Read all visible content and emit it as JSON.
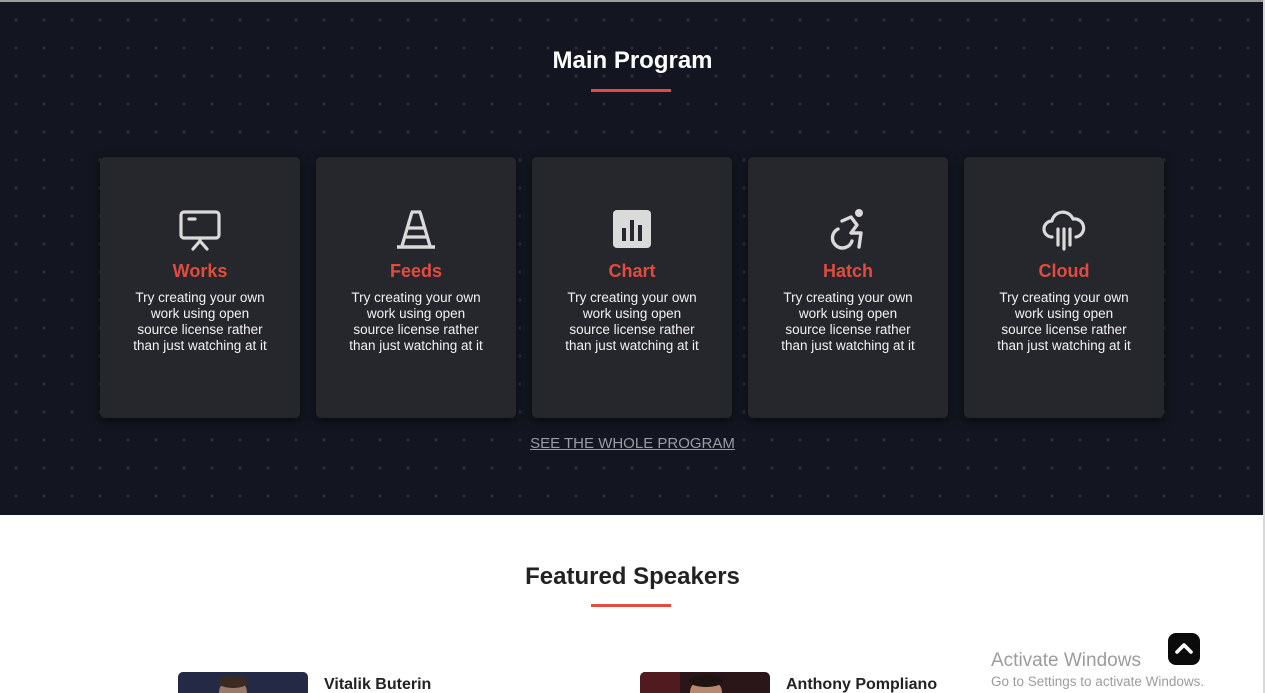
{
  "program": {
    "title": "Main Program",
    "cards": [
      {
        "icon": "presentation-icon",
        "title": "Works",
        "desc": "Try creating your own work using open source license rather than just watching at it"
      },
      {
        "icon": "road-cone-icon",
        "title": "Feeds",
        "desc": "Try creating your own work using open source license rather than just watching at it"
      },
      {
        "icon": "bar-chart-icon",
        "title": "Chart",
        "desc": "Try creating your own work using open source license rather than just watching at it"
      },
      {
        "icon": "accessibility-icon",
        "title": "Hatch",
        "desc": "Try creating your own work using open source license rather than just watching at it"
      },
      {
        "icon": "cloud-download-icon",
        "title": "Cloud",
        "desc": "Try creating your own work using open source license rather than just watching at it"
      }
    ],
    "cta": "SEE THE WHOLE PROGRAM"
  },
  "speakers": {
    "title": "Featured Speakers",
    "list": [
      {
        "name": "Vitalik Buterin"
      },
      {
        "name": "Anthony Pompliano"
      }
    ]
  },
  "overlay": {
    "activate_title": "Activate Windows",
    "activate_sub": "Go to Settings to activate Windows."
  },
  "colors": {
    "accent": "#e34b3f",
    "dark_bg": "#131620",
    "card_bg": "#26272c"
  }
}
